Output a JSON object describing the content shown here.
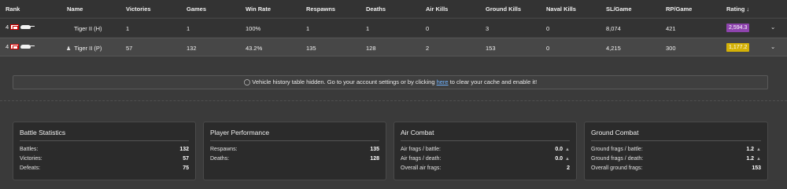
{
  "headers": {
    "rank": "Rank",
    "name": "Name",
    "victories": "Victories",
    "games": "Games",
    "win_rate": "Win Rate",
    "respawns": "Respawns",
    "deaths": "Deaths",
    "air_kills": "Air Kills",
    "ground_kills": "Ground Kills",
    "naval_kills": "Naval Kills",
    "sl_game": "SL/Game",
    "rp_game": "RP/Game",
    "rating": "Rating ↓"
  },
  "rows": [
    {
      "rank": "4",
      "name": "Tiger II (H)",
      "victories": "1",
      "games": "1",
      "win_rate": "100%",
      "respawns": "1",
      "deaths": "1",
      "air_kills": "0",
      "ground_kills": "3",
      "naval_kills": "0",
      "sl_game": "8,074",
      "rp_game": "421",
      "rating": "2,594.3",
      "rating_color": "#8e44ad"
    },
    {
      "rank": "4",
      "name": "Tiger II (P)",
      "victories": "57",
      "games": "132",
      "win_rate": "43.2%",
      "respawns": "135",
      "deaths": "128",
      "air_kills": "2",
      "ground_kills": "153",
      "naval_kills": "0",
      "sl_game": "4,215",
      "rp_game": "300",
      "rating": "1,177.2",
      "rating_color": "#d4b106"
    }
  ],
  "notice": {
    "icon": "eye-slash-icon",
    "text_before": "Vehicle history table hidden. Go to your account settings or by clicking",
    "link": "here",
    "text_after": "to clear your cache and enable it!"
  },
  "cards": {
    "battle": {
      "title": "Battle Statistics",
      "battles_label": "Battles:",
      "battles": "132",
      "victories_label": "Victories:",
      "victories": "57",
      "defeats_label": "Defeats:",
      "defeats": "75"
    },
    "performance": {
      "title": "Player Performance",
      "respawns_label": "Respawns:",
      "respawns": "135",
      "deaths_label": "Deaths:",
      "deaths": "128"
    },
    "air": {
      "title": "Air Combat",
      "per_battle_label": "Air frags / battle:",
      "per_battle": "0.0",
      "per_death_label": "Air frags / death:",
      "per_death": "0.0",
      "overall_label": "Overall air frags:",
      "overall": "2"
    },
    "ground": {
      "title": "Ground Combat",
      "per_battle_label": "Ground frags / battle:",
      "per_battle": "1.2",
      "per_death_label": "Ground frags / death:",
      "per_death": "1.2",
      "overall_label": "Overall ground frags:",
      "overall": "153"
    }
  },
  "colors": {
    "background": "#3a3a3a",
    "link": "#6fb3ff",
    "rating_purple": "#8e44ad",
    "rating_yellow": "#d4b106"
  }
}
